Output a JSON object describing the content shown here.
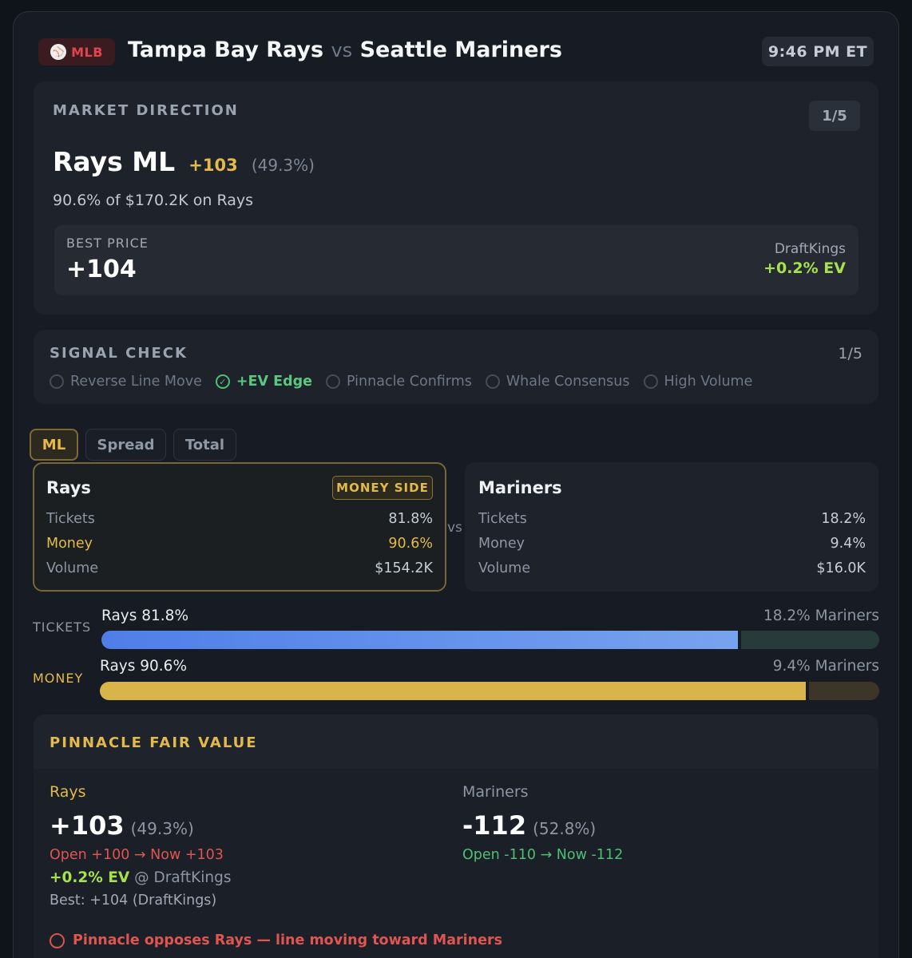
{
  "header": {
    "sport": "MLB",
    "sport_icon": "baseball-icon",
    "team_a": "Tampa Bay Rays",
    "vs": "vs",
    "team_b": "Seattle Mariners",
    "time": "9:46 PM ET"
  },
  "market_direction": {
    "label": "MARKET DIRECTION",
    "count": "1/5",
    "pick": "Rays ML",
    "odds": "+103",
    "pct": "(49.3%)",
    "sub": "90.6% of $170.2K on Rays",
    "best_price_label": "BEST PRICE",
    "best_price": "+104",
    "book": "DraftKings",
    "ev": "+0.2% EV"
  },
  "signal_check": {
    "label": "SIGNAL CHECK",
    "count": "1/5",
    "signals": [
      {
        "label": "Reverse Line Move",
        "active": false
      },
      {
        "label": "+EV Edge",
        "active": true
      },
      {
        "label": "Pinnacle Confirms",
        "active": false
      },
      {
        "label": "Whale Consensus",
        "active": false
      },
      {
        "label": "High Volume",
        "active": false
      }
    ]
  },
  "tabs": [
    {
      "label": "ML",
      "active": true
    },
    {
      "label": "Spread",
      "active": false
    },
    {
      "label": "Total",
      "active": false
    }
  ],
  "teams": {
    "vs": "vs",
    "left": {
      "name": "Rays",
      "badge": "MONEY SIDE",
      "rows": [
        {
          "label": "Tickets",
          "value": "81.8%"
        },
        {
          "label": "Money",
          "value": "90.6%"
        },
        {
          "label": "Volume",
          "value": "$154.2K"
        }
      ]
    },
    "right": {
      "name": "Mariners",
      "rows": [
        {
          "label": "Tickets",
          "value": "18.2%"
        },
        {
          "label": "Money",
          "value": "9.4%"
        },
        {
          "label": "Volume",
          "value": "$16.0K"
        }
      ]
    }
  },
  "bars": {
    "tickets": {
      "label": "TICKETS",
      "left": "Rays 81.8%",
      "right": "18.2% Mariners",
      "fraction": 0.818
    },
    "money": {
      "label": "MONEY",
      "left": "Rays 90.6%",
      "right": "9.4% Mariners",
      "fraction": 0.906
    }
  },
  "pinnacle": {
    "label": "PINNACLE FAIR VALUE",
    "left": {
      "team": "Rays",
      "odds": "+103",
      "pct": "(49.3%)",
      "movement": "Open +100 → Now +103",
      "ev": "+0.2% EV",
      "ev_book": "@ DraftKings",
      "best": "Best: +104 (DraftKings)"
    },
    "right": {
      "team": "Mariners",
      "odds": "-112",
      "pct": "(52.8%)",
      "movement": "Open -110 → Now -112"
    },
    "warning": "Pinnacle opposes Rays — line moving toward Mariners"
  },
  "colors": {
    "gold": "#e3b94a",
    "green": "#4fbf72",
    "lime": "#a7e24d",
    "red": "#e0554f",
    "blue": "#4f7ee8"
  }
}
